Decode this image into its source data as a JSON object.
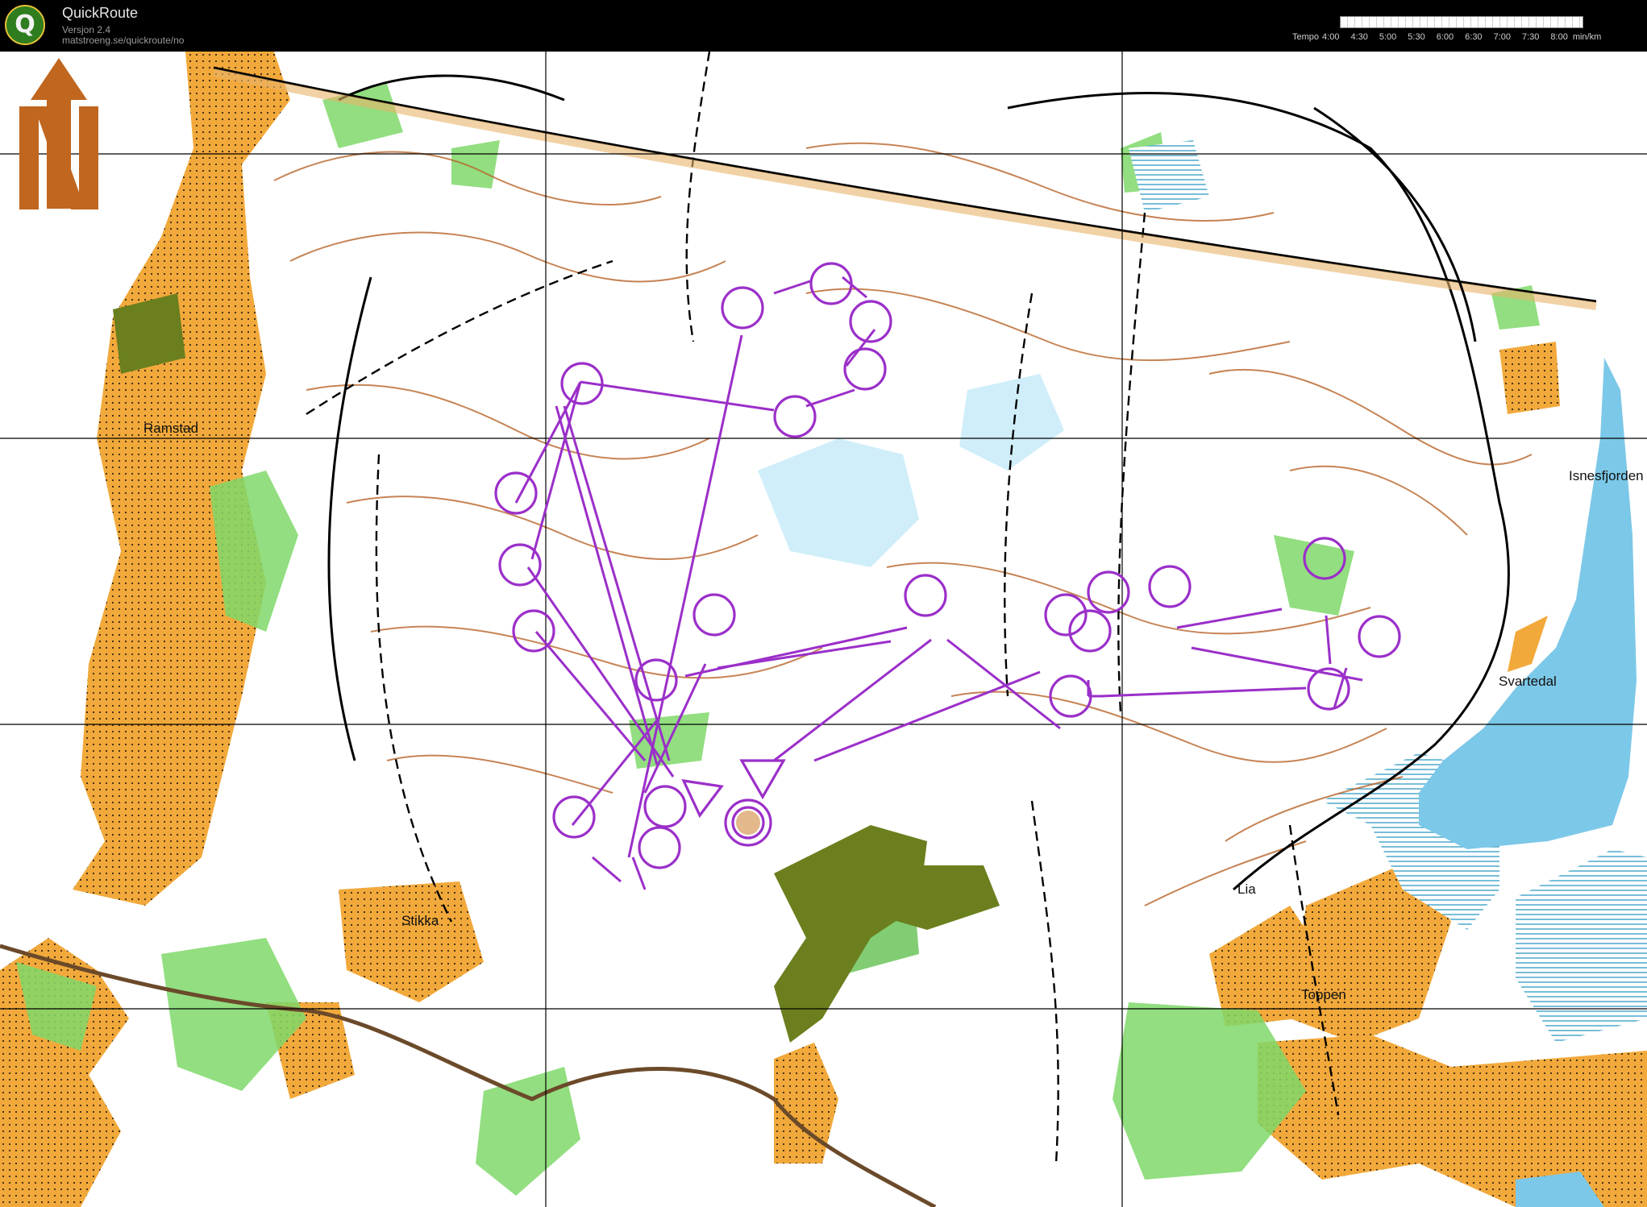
{
  "app": {
    "logo_letter": "Q",
    "name": "QuickRoute",
    "version": "Versjon 2.4",
    "url": "matstroeng.se/quickroute/no"
  },
  "tempo_legend": {
    "label": "Tempo",
    "ticks": [
      "4:00",
      "4:30",
      "5:00",
      "5:30",
      "6:00",
      "6:30",
      "7:00",
      "7:30",
      "8:00"
    ],
    "unit": "min/km"
  },
  "map": {
    "place_names": [
      "Ramstad",
      "Stikka",
      "Isnesfjorden",
      "Svartedal",
      "Lia",
      "Toppen"
    ],
    "north_arrow_icon": "north-arrow-icon",
    "colors": {
      "course": "#9b2fc9",
      "open_land": "#f2a93b",
      "forest_green": "#7fd86a",
      "water": "#7cc8e8",
      "contour": "#b8652a"
    }
  }
}
